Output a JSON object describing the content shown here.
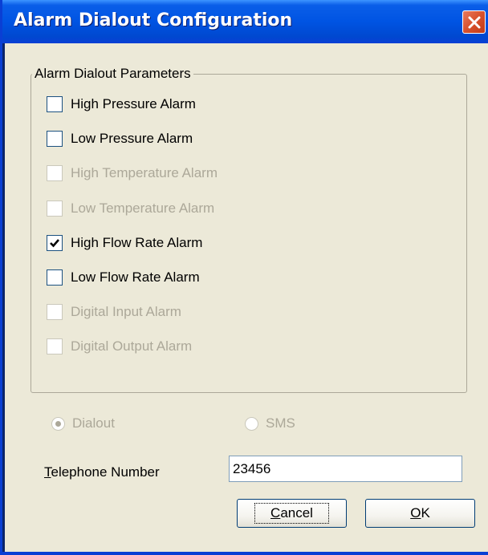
{
  "window": {
    "title": "Alarm Dialout Configuration"
  },
  "group": {
    "label": "Alarm Dialout Parameters",
    "items": [
      {
        "label": "High Pressure Alarm",
        "checked": false,
        "enabled": true
      },
      {
        "label": "Low Pressure Alarm",
        "checked": false,
        "enabled": true
      },
      {
        "label": "High Temperature Alarm",
        "checked": false,
        "enabled": false
      },
      {
        "label": "Low Temperature Alarm",
        "checked": false,
        "enabled": false
      },
      {
        "label": "High Flow Rate Alarm",
        "checked": true,
        "enabled": true
      },
      {
        "label": "Low Flow Rate Alarm",
        "checked": false,
        "enabled": true
      },
      {
        "label": "Digital Input Alarm",
        "checked": false,
        "enabled": false
      },
      {
        "label": "Digital Output Alarm",
        "checked": false,
        "enabled": false
      }
    ]
  },
  "mode": {
    "dialout_label": "Dialout",
    "sms_label": "SMS",
    "selected": "Dialout"
  },
  "telephone": {
    "label_first": "T",
    "label_rest": "elephone Number",
    "value": "23456"
  },
  "buttons": {
    "cancel_first": "C",
    "cancel_rest": "ancel",
    "ok_first": "O",
    "ok_rest": "K"
  },
  "colors": {
    "titlebar": "#0054e3",
    "client": "#ece9d8",
    "close": "#d8512c",
    "disabled_text": "#aca899"
  }
}
